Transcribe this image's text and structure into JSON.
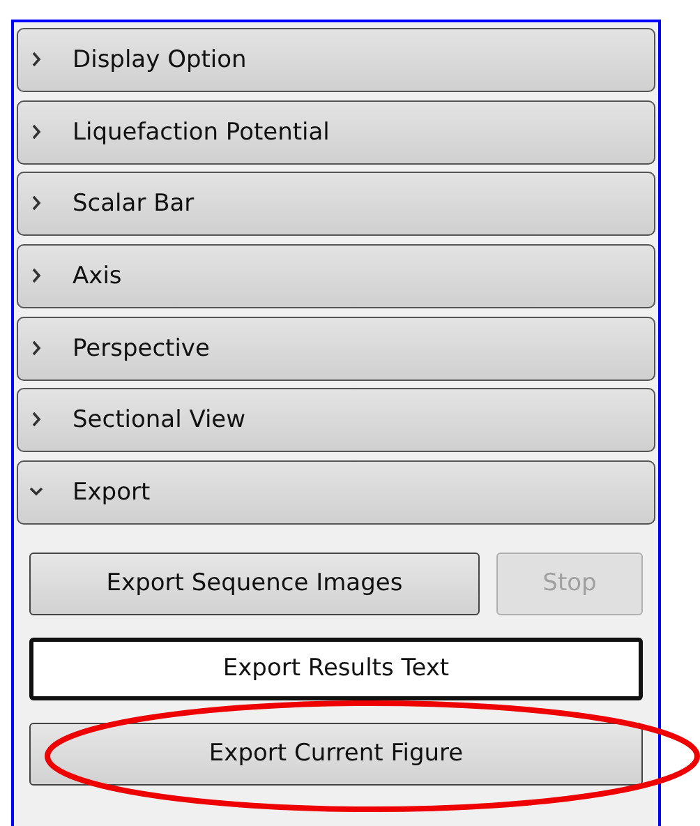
{
  "sections": [
    {
      "title": "Display Option",
      "expanded": false
    },
    {
      "title": "Liquefaction Potential",
      "expanded": false
    },
    {
      "title": "Scalar Bar",
      "expanded": false
    },
    {
      "title": "Axis",
      "expanded": false
    },
    {
      "title": "Perspective",
      "expanded": false
    },
    {
      "title": "Sectional View",
      "expanded": false
    },
    {
      "title": "Export",
      "expanded": true,
      "button_rows": [
        [
          {
            "label": "Export Sequence Images",
            "disabled": false,
            "focused": false
          },
          {
            "label": "Stop",
            "disabled": true,
            "focused": false
          }
        ],
        [
          {
            "label": "Export Results Text",
            "disabled": false,
            "focused": true
          }
        ],
        [
          {
            "label": "Export Current Figure",
            "disabled": false,
            "focused": false
          }
        ]
      ]
    }
  ]
}
